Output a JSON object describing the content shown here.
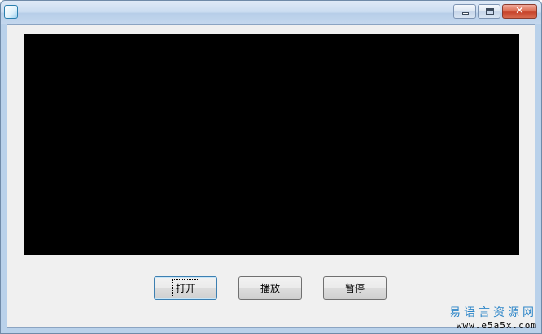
{
  "window": {
    "icon": "easy-language-app-icon",
    "caption_buttons": [
      "minimize-icon",
      "maximize-icon",
      "close-icon"
    ],
    "close_glyph": "✕"
  },
  "video_area": {
    "color": "#000000"
  },
  "buttons": {
    "open_label": "打开",
    "play_label": "播放",
    "pause_label": "暂停"
  },
  "watermark": {
    "title": "易语言资源网",
    "url": "www.e5a5x.com",
    "title_color": "#2e86c8"
  }
}
